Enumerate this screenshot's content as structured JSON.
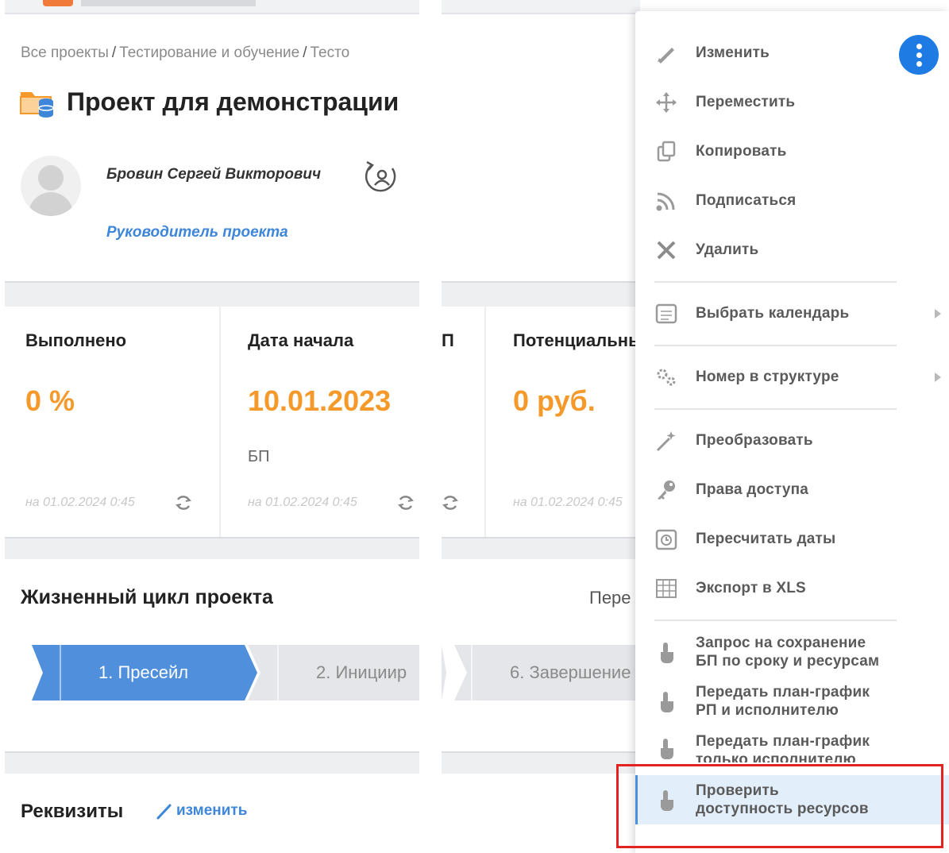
{
  "breadcrumb": {
    "items": [
      "Все проекты",
      "Тестирование и обучение",
      "Тесто"
    ],
    "separator": "/"
  },
  "project": {
    "title": "Проект для демонстрации"
  },
  "manager": {
    "name": "Бровин Сергей Викторович",
    "role": "Руководитель проекта"
  },
  "stats": [
    {
      "label": "Выполнено",
      "value": "0 %",
      "sub": "",
      "date": "на 01.02.2024 0:45"
    },
    {
      "label": "Дата начала",
      "value": "10.01.2023",
      "sub": "БП",
      "date": "на 01.02.2024 0:45"
    },
    {
      "label": "П",
      "value": "",
      "sub": "",
      "date": ""
    },
    {
      "label": "Потенциальны",
      "value": "0 руб.",
      "sub": "",
      "date": "на 01.02.2024 0:45"
    }
  ],
  "lifecycle": {
    "title": "Жизненный цикл проекта",
    "right_text": "Пере",
    "stages": [
      "1. Пресейл",
      "2. Иницииp",
      "6. Завершение"
    ]
  },
  "requisites": {
    "title": "Реквизиты",
    "edit_label": "изменить"
  },
  "menu": {
    "items": [
      {
        "label": "Изменить",
        "icon": "pencil-icon"
      },
      {
        "label": "Переместить",
        "icon": "move-icon"
      },
      {
        "label": "Копировать",
        "icon": "copy-icon"
      },
      {
        "label": "Подписаться",
        "icon": "rss-icon"
      },
      {
        "label": "Удалить",
        "icon": "close-icon"
      },
      {
        "label": "Выбрать календарь",
        "icon": "calendar-icon"
      },
      {
        "label": "Номер в структуре",
        "icon": "gears-icon"
      },
      {
        "label": "Преобразовать",
        "icon": "magic-wand-icon"
      },
      {
        "label": "Права доступа",
        "icon": "key-icon"
      },
      {
        "label": "Пересчитать даты",
        "icon": "clock-icon"
      },
      {
        "label": "Экспорт в XLS",
        "icon": "table-icon"
      },
      {
        "label_line1": "Запрос на сохранение",
        "label_line2": "БП по сроку и ресурсам",
        "icon": "hand-pointer-icon"
      },
      {
        "label_line1": "Передать план-график",
        "label_line2": "РП и исполнителю",
        "icon": "hand-pointer-icon"
      },
      {
        "label_line1": "Передать план-график",
        "label_line2": "только исполнителю",
        "icon": "hand-pointer-icon"
      },
      {
        "label_line1": "Проверить",
        "label_line2": "доступность ресурсов",
        "icon": "hand-pointer-icon"
      }
    ]
  },
  "colors": {
    "accent_orange": "#f59a2a",
    "link_blue": "#3d86d9",
    "stage_active": "#4f8fdb",
    "highlight_red": "#e32222"
  }
}
